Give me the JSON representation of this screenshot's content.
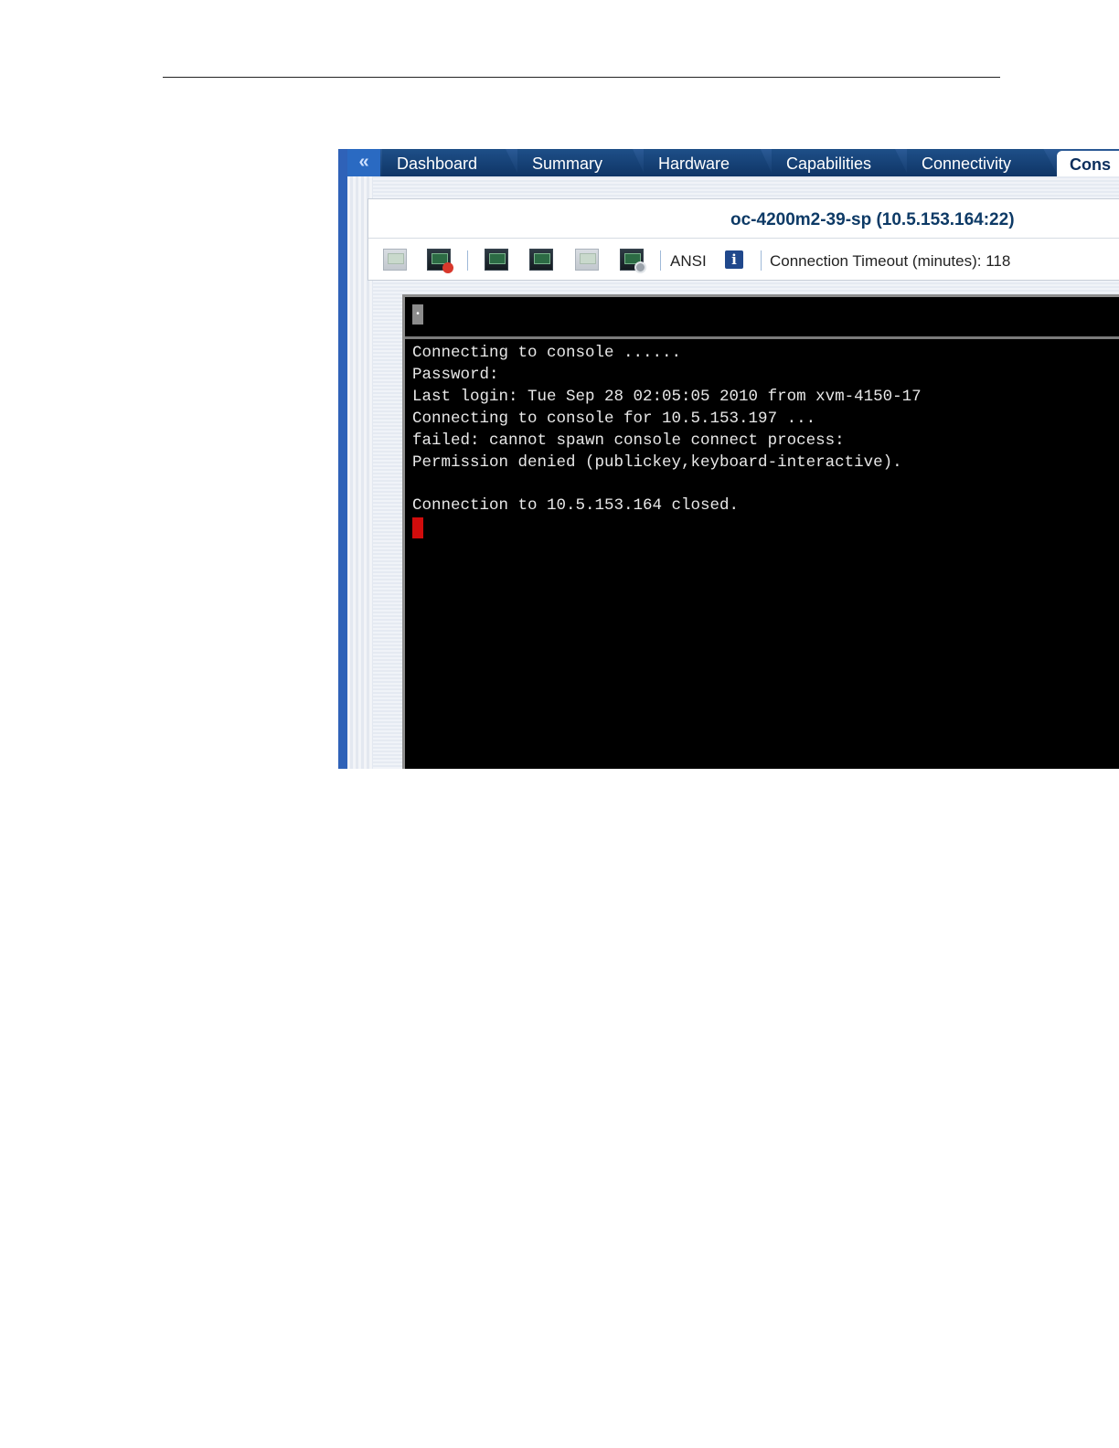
{
  "tabs": [
    {
      "label": "Dashboard"
    },
    {
      "label": "Summary"
    },
    {
      "label": "Hardware"
    },
    {
      "label": "Capabilities"
    },
    {
      "label": "Connectivity"
    },
    {
      "label": "Cons",
      "active": true
    }
  ],
  "collapse_glyph": "«",
  "panel": {
    "title": "oc-4200m2-39-sp (10.5.153.164:22)"
  },
  "toolbar": {
    "icons": [
      "connect-icon",
      "disconnect-icon",
      "console-icon",
      "console-refresh-icon",
      "console-disabled-icon",
      "console-settings-icon",
      "info-icon"
    ],
    "encoding": "ANSI",
    "info_glyph": "i",
    "timeout_label": "Connection Timeout (minutes):",
    "timeout_value": "118"
  },
  "terminal": {
    "menu_glyph": "•",
    "lines": [
      "Connecting to console ......",
      "Password:",
      "Last login: Tue Sep 28 02:05:05 2010 from xvm-4150-17",
      "Connecting to console for 10.5.153.197 ...",
      "failed: cannot spawn console connect process:",
      "Permission denied (publickey,keyboard-interactive).",
      "",
      "Connection to 10.5.153.164 closed."
    ]
  }
}
